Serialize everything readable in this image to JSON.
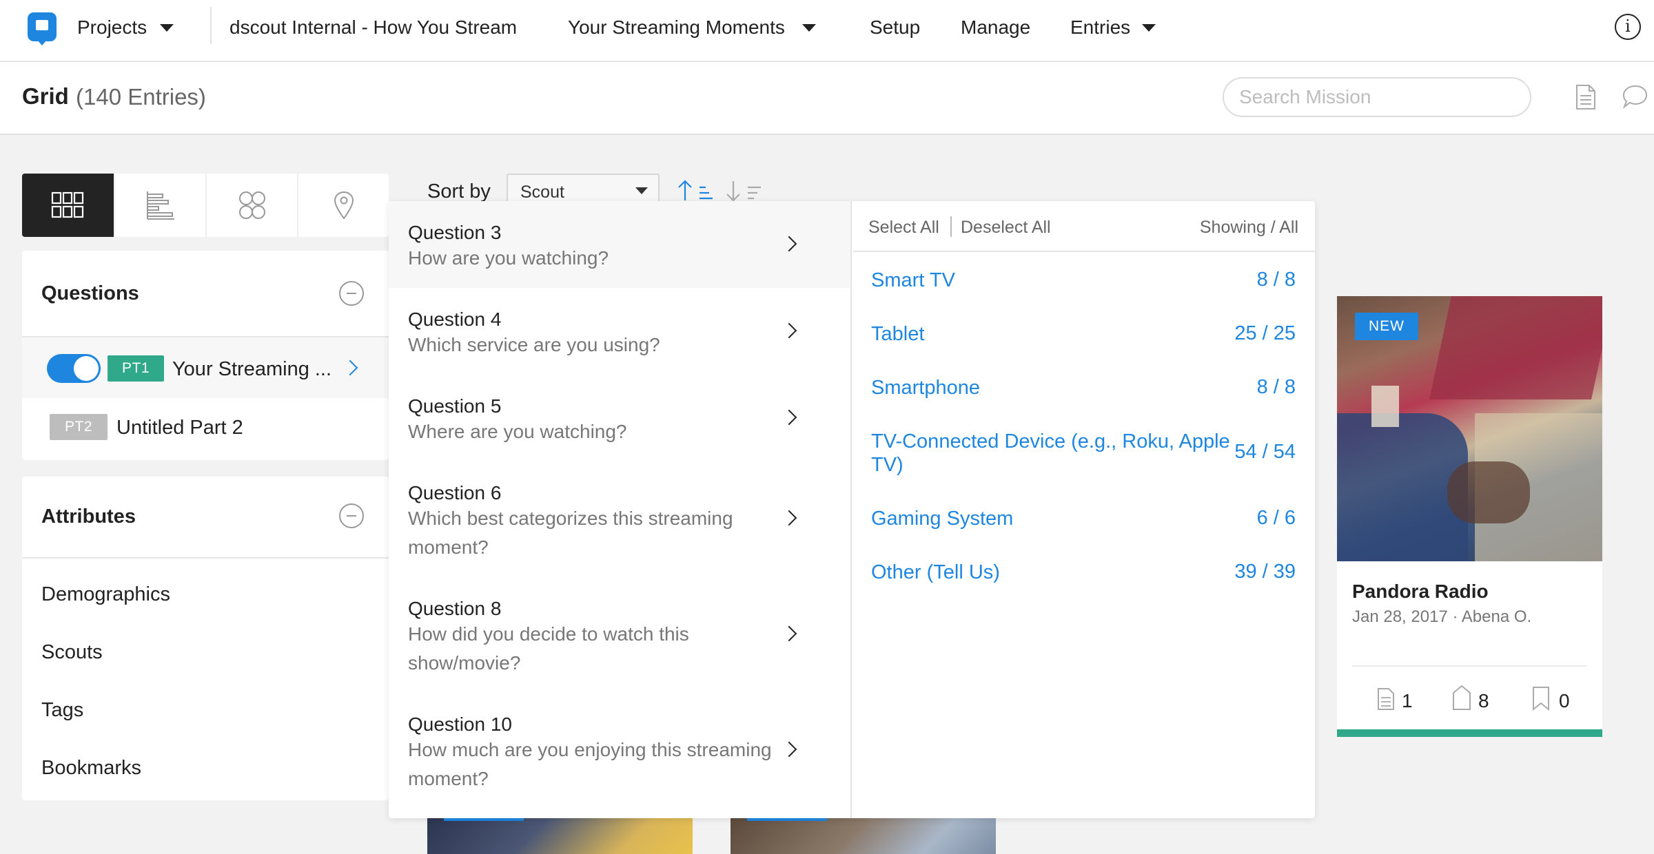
{
  "nav": {
    "projects_label": "Projects",
    "mission_name": "dscout Internal - How You Stream",
    "part_name": "Your Streaming Moments",
    "setup_label": "Setup",
    "manage_label": "Manage",
    "entries_label": "Entries"
  },
  "subheader": {
    "title": "Grid",
    "count": "(140 Entries)",
    "search_placeholder": "Search Mission"
  },
  "sort": {
    "label": "Sort by",
    "selected": "Scout"
  },
  "questions_panel": {
    "title": "Questions",
    "parts": [
      {
        "badge": "PT1",
        "label": "Your Streaming ...",
        "enabled": true
      },
      {
        "badge": "PT2",
        "label": "Untitled Part 2",
        "enabled": false
      }
    ]
  },
  "attributes_panel": {
    "title": "Attributes",
    "items": [
      "Demographics",
      "Scouts",
      "Tags",
      "Bookmarks"
    ]
  },
  "dropdown": {
    "questions": [
      {
        "title": "Question 3",
        "text": "How are you watching?"
      },
      {
        "title": "Question 4",
        "text": "Which service are you using?"
      },
      {
        "title": "Question 5",
        "text": "Where are you watching?"
      },
      {
        "title": "Question 6",
        "text": "Which best categorizes this streaming moment?"
      },
      {
        "title": "Question 8",
        "text": "How did you decide to watch this show/movie?"
      },
      {
        "title": "Question 10",
        "text": "How much are you enjoying this streaming moment?"
      }
    ],
    "select_all": "Select All",
    "deselect_all": "Deselect All",
    "showing": "Showing / All",
    "options": [
      {
        "name": "Smart TV",
        "count": "8 / 8"
      },
      {
        "name": "Tablet",
        "count": "25 / 25"
      },
      {
        "name": "Smartphone",
        "count": "8 / 8"
      },
      {
        "name": "TV-Connected Device (e.g., Roku, Apple TV)",
        "count": "54 / 54"
      },
      {
        "name": "Gaming System",
        "count": "6 / 6"
      },
      {
        "name": "Other (Tell Us)",
        "count": "39 / 39"
      }
    ]
  },
  "card": {
    "tag": "NEW",
    "title": "Pandora Radio",
    "meta": "Jan 28, 2017 · Abena O.",
    "notes": "1",
    "tags": "8",
    "bookmarks": "0"
  },
  "colors": {
    "accent": "#1f86e0",
    "part1_badge": "#2fa98a",
    "part2_badge": "#bdbdbd",
    "card_bar": "#2fa98a"
  }
}
